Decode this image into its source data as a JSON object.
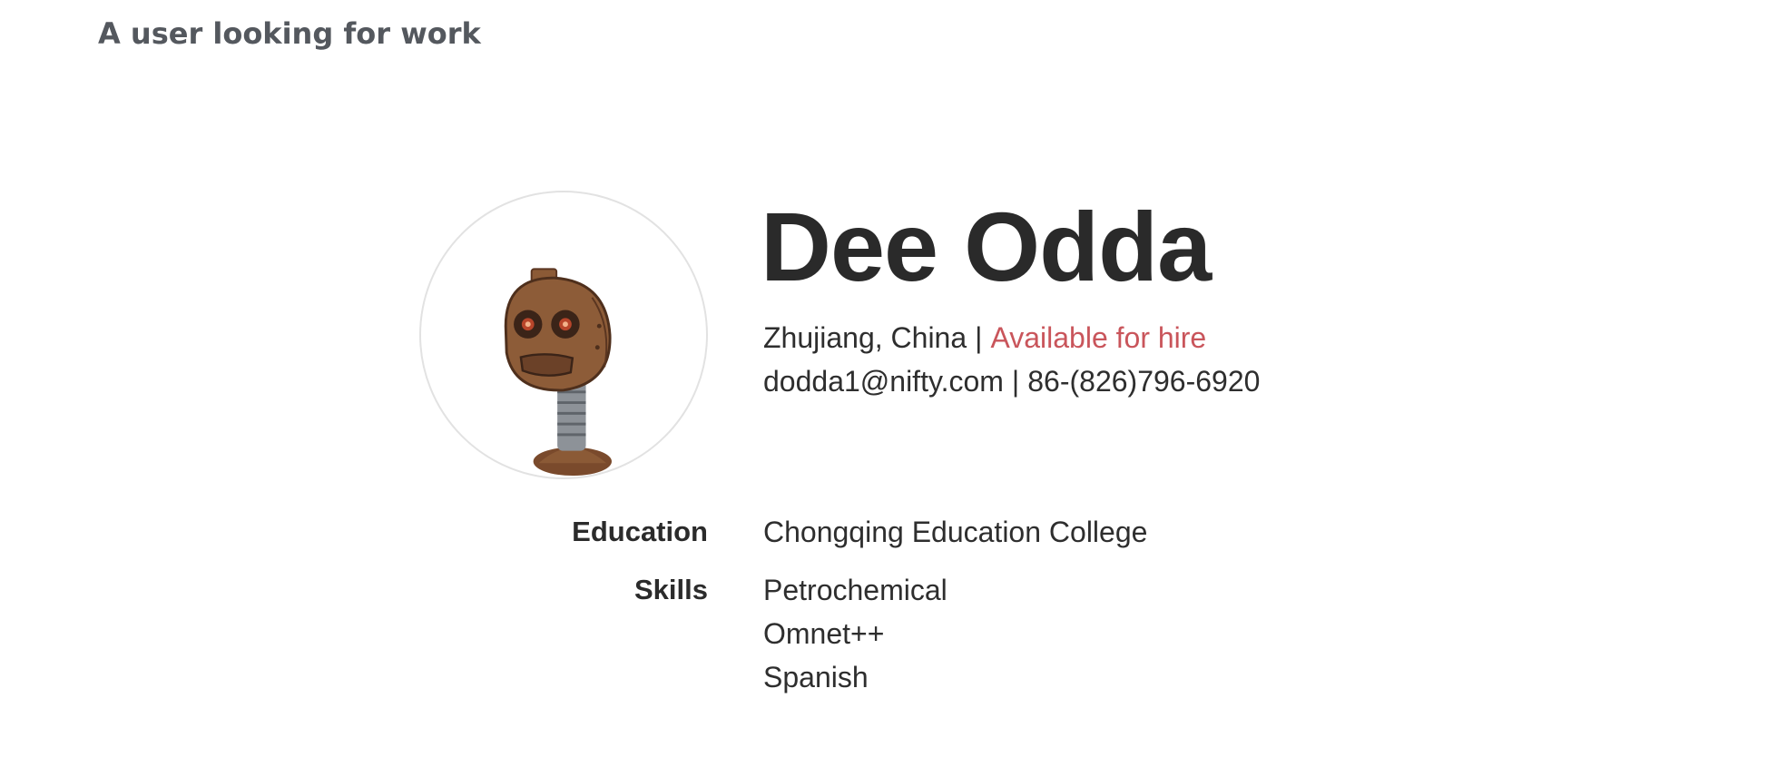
{
  "page": {
    "heading": "A user looking for work"
  },
  "profile": {
    "name": "Dee Odda",
    "location": "Zhujiang, China",
    "availability": "Available for hire",
    "email": "dodda1@nifty.com",
    "phone": "86-(826)796-6920",
    "separator": "|",
    "avatar_icon": "robot-avatar-icon"
  },
  "details": {
    "education_label": "Education",
    "education_value": "Chongqing Education College",
    "skills_label": "Skills",
    "skills": [
      "Petrochemical",
      "Omnet++",
      "Spanish"
    ]
  },
  "colors": {
    "heading": "#54585e",
    "availability": "#c9555b",
    "text": "#2e2e2e",
    "avatar_border": "#e2e2e2"
  }
}
